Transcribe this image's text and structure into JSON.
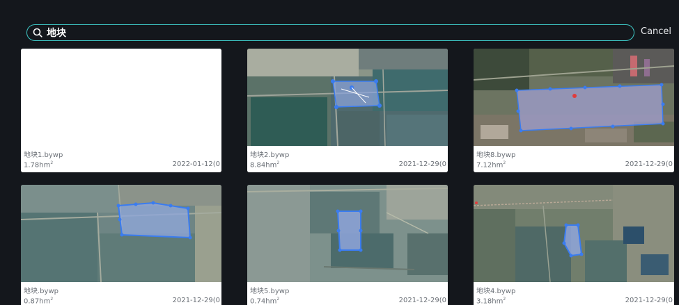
{
  "search": {
    "value": "地块",
    "cancel_label": "Cancel"
  },
  "colors": {
    "background": "#14171c",
    "accent": "#3ec9c7",
    "boundary": "#3a7cf0"
  },
  "files": [
    {
      "name": "地块1.bywp",
      "area_value": "1.78hm",
      "area_unit_sup": "2",
      "date": "2022-01-12(0"
    },
    {
      "name": "地块2.bywp",
      "area_value": "8.84hm",
      "area_unit_sup": "2",
      "date": "2021-12-29(0"
    },
    {
      "name": "地块8.bywp",
      "area_value": "7.12hm",
      "area_unit_sup": "2",
      "date": "2021-12-29(0"
    },
    {
      "name": "地块.bywp",
      "area_value": "0.87hm",
      "area_unit_sup": "2",
      "date": "2021-12-29(0"
    },
    {
      "name": "地块5.bywp",
      "area_value": "0.74hm",
      "area_unit_sup": "2",
      "date": "2021-12-29(0"
    },
    {
      "name": "地块4.bywp",
      "area_value": "3.18hm",
      "area_unit_sup": "2",
      "date": "2021-12-29(0"
    }
  ]
}
